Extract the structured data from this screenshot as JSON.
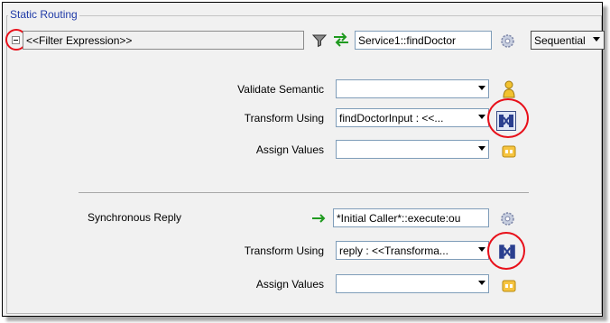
{
  "panel": {
    "legend": "Static Routing"
  },
  "filter": {
    "placeholder_text": "<<Filter Expression>>"
  },
  "service": {
    "value": "Service1::findDoctor"
  },
  "execution": {
    "selected": "Sequential"
  },
  "request": {
    "validate_label": "Validate Semantic",
    "validate_value": "",
    "transform_label": "Transform Using",
    "transform_value": "findDoctorInput : <<...",
    "assign_label": "Assign Values",
    "assign_value": ""
  },
  "reply": {
    "sync_label": "Synchronous Reply",
    "target_value": "*Initial Caller*::execute:ou",
    "transform_label": "Transform Using",
    "transform_value": "reply : <<Transforma...",
    "assign_label": "Assign Values",
    "assign_value": ""
  },
  "colors": {
    "highlight_circle": "#e8101a",
    "legend_text": "#1f3aa7",
    "panel_bg": "#f1f1f1"
  },
  "icons": [
    "collapse-icon",
    "filter-funnel-icon",
    "swap-arrows-icon",
    "gear-icon",
    "validate-person-icon",
    "xslt-map-icon",
    "assign-values-icon",
    "reply-arrow-icon"
  ]
}
